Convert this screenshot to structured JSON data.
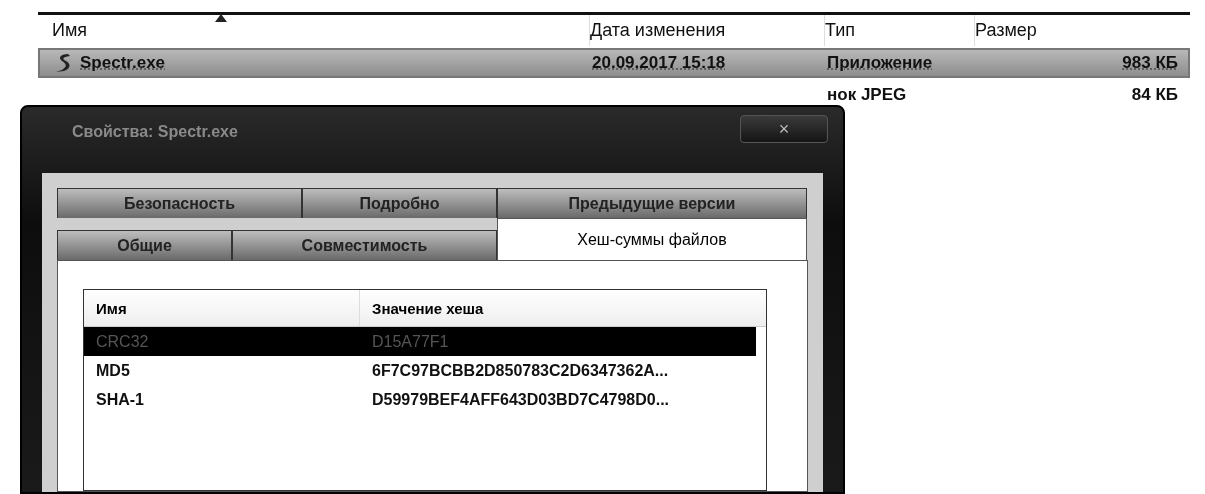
{
  "explorer": {
    "columns": [
      {
        "label": "Имя"
      },
      {
        "label": "Дата изменения"
      },
      {
        "label": "Тип"
      },
      {
        "label": "Размер"
      }
    ],
    "rows": [
      {
        "name": "Spectr.exe",
        "date": "20.09.2017 15:18",
        "type": "Приложение",
        "size": "983 КБ",
        "selected": true
      },
      {
        "type": "нок JPEG",
        "size": "84 КБ",
        "selected": false
      }
    ]
  },
  "dialog": {
    "title": "Свойства: Spectr.exe",
    "close": "×",
    "tab_rows": [
      [
        {
          "label": "Безопасность",
          "selected": false
        },
        {
          "label": "Подробно",
          "selected": false
        },
        {
          "label": "Предыдущие версии",
          "selected": false
        }
      ],
      [
        {
          "label": "Общие",
          "selected": false
        },
        {
          "label": "Совместимость",
          "selected": false
        },
        {
          "label": "Хеш-суммы файлов",
          "selected": true
        }
      ]
    ],
    "hash_list": {
      "columns": [
        "Имя",
        "Значение хеша"
      ],
      "rows": [
        {
          "name": "CRC32",
          "value": "D15A77F1",
          "selected": true
        },
        {
          "name": "MD5",
          "value": "6F7C97BCBB2D850783C2D6347362A...",
          "selected": false
        },
        {
          "name": "SHA-1",
          "value": "D59979BEF4AFF643D03BD7C4798D0...",
          "selected": false
        }
      ]
    }
  }
}
